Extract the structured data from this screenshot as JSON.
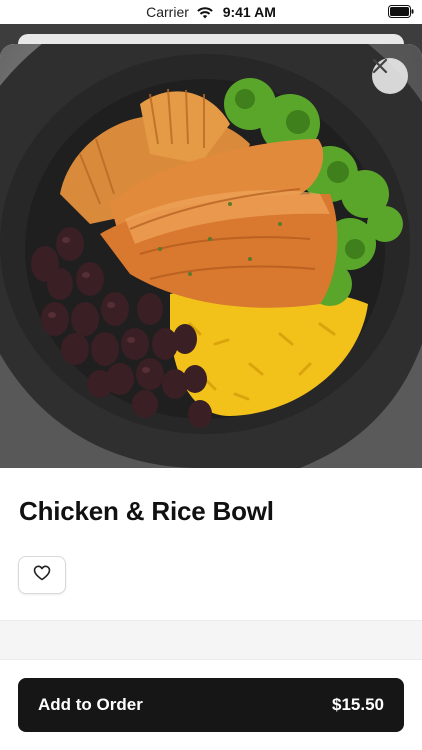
{
  "status_bar": {
    "carrier": "Carrier",
    "time": "9:41 AM",
    "icons": [
      "wifi-icon",
      "battery-icon"
    ]
  },
  "item": {
    "name": "Chicken & Rice Bowl",
    "image_alt": "Chicken and rice bowl photo",
    "favorite_icon": "heart-icon",
    "close_icon": "close-icon"
  },
  "order": {
    "button_label": "Add to Order",
    "price": "$15.50"
  },
  "colors": {
    "primary_button": "#161616",
    "background": "#ffffff"
  }
}
